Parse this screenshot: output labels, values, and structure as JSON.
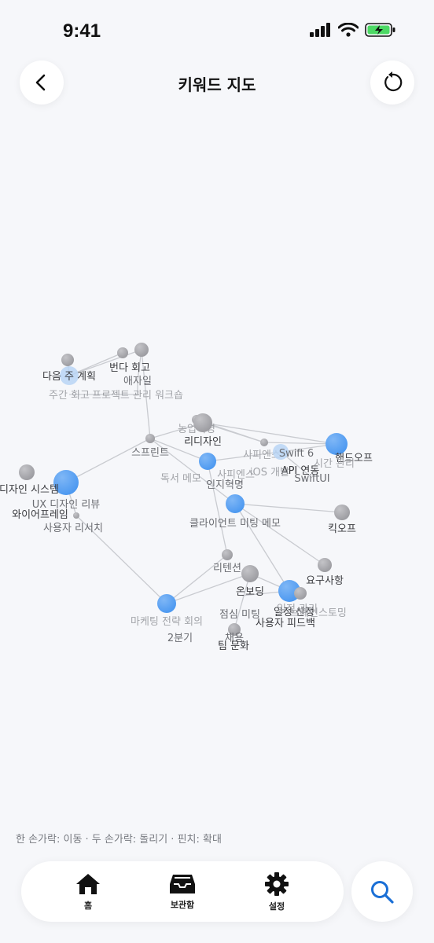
{
  "status": {
    "time": "9:41"
  },
  "header": {
    "title": "키워드 지도",
    "back_icon": "chevron-left-icon",
    "reset_icon": "refresh-icon"
  },
  "map": {
    "colors": {
      "accent": "#4a97f0",
      "light": "#b9d5f5",
      "gray": "#a9a9ad",
      "edge": "#c9cbd0"
    },
    "nodes": [
      {
        "id": "n1",
        "label": "다음 주 계획",
        "kind": "light",
        "emphasis": "dark"
      },
      {
        "id": "n2",
        "label": "",
        "kind": "gray"
      },
      {
        "id": "n3",
        "label": "번다 회고",
        "kind": "gray",
        "emphasis": "dark"
      },
      {
        "id": "n4",
        "label": "",
        "kind": "gray"
      },
      {
        "id": "n5",
        "label": "애자일",
        "kind": "light",
        "emphasis": "mid"
      },
      {
        "id": "n6",
        "label": "주간 회고",
        "kind": "none",
        "emphasis": "faint"
      },
      {
        "id": "n7",
        "label": "프로젝트 관리 워크숍",
        "kind": "none",
        "emphasis": "faint"
      },
      {
        "id": "n8",
        "label": "농업혁명",
        "kind": "gray",
        "emphasis": "faint"
      },
      {
        "id": "n9",
        "label": "리디자인",
        "kind": "gray",
        "emphasis": "dark"
      },
      {
        "id": "n10",
        "label": "스프린트",
        "kind": "gray-small",
        "emphasis": "mid"
      },
      {
        "id": "n11",
        "label": "",
        "kind": "accent"
      },
      {
        "id": "n12",
        "label": "사피엔스",
        "kind": "gray-small",
        "emphasis": "faint"
      },
      {
        "id": "n13",
        "label": "Swift 6",
        "kind": "light",
        "emphasis": "mid"
      },
      {
        "id": "n14",
        "label": "핸드오프",
        "kind": "accent",
        "emphasis": "dark"
      },
      {
        "id": "n15",
        "label": "API 연동",
        "kind": "light",
        "emphasis": "dark"
      },
      {
        "id": "n16",
        "label": "iOS 개발",
        "kind": "none",
        "emphasis": "faint"
      },
      {
        "id": "n17",
        "label": "시간 관리",
        "kind": "none",
        "emphasis": "faint"
      },
      {
        "id": "n18",
        "label": "SwiftUI",
        "kind": "none",
        "emphasis": "mid"
      },
      {
        "id": "n19",
        "label": "독서 메모",
        "kind": "none",
        "emphasis": "faint"
      },
      {
        "id": "n20",
        "label": "사피엔스",
        "kind": "none",
        "emphasis": "faint"
      },
      {
        "id": "n21",
        "label": "인지혁명",
        "kind": "none",
        "emphasis": "mid"
      },
      {
        "id": "n22",
        "label": "디자인 시스템",
        "kind": "accent",
        "emphasis": "dark"
      },
      {
        "id": "n23",
        "label": "",
        "kind": "gray"
      },
      {
        "id": "n24",
        "label": "UX 디자인 리뷰",
        "kind": "none",
        "emphasis": "mid"
      },
      {
        "id": "n25",
        "label": "와이어프레임",
        "kind": "gray-tiny",
        "emphasis": "dark"
      },
      {
        "id": "n26",
        "label": "사용자 리서치",
        "kind": "none",
        "emphasis": "mid"
      },
      {
        "id": "n27",
        "label": "클라이언트 미팅 메모",
        "kind": "accent",
        "emphasis": "mid"
      },
      {
        "id": "n28",
        "label": "킥오프",
        "kind": "gray",
        "emphasis": "dark"
      },
      {
        "id": "n29",
        "label": "요구사항",
        "kind": "gray",
        "emphasis": "dark"
      },
      {
        "id": "n30",
        "label": "리텐션",
        "kind": "gray-small",
        "emphasis": "mid"
      },
      {
        "id": "n31",
        "label": "온보딩",
        "kind": "gray",
        "emphasis": "dark"
      },
      {
        "id": "n32",
        "label": "일정 산정",
        "kind": "accent",
        "emphasis": "dark"
      },
      {
        "id": "n33",
        "label": "일정 관리",
        "kind": "none",
        "emphasis": "faint"
      },
      {
        "id": "n34",
        "label": "브레인스토밍",
        "kind": "none",
        "emphasis": "faint"
      },
      {
        "id": "n35",
        "label": "사용자 피드백",
        "kind": "gray",
        "emphasis": "dark"
      },
      {
        "id": "n36",
        "label": "점심 미팅",
        "kind": "light",
        "emphasis": "mid"
      },
      {
        "id": "n37",
        "label": "마케팅 전략 회의",
        "kind": "accent",
        "emphasis": "faint"
      },
      {
        "id": "n38",
        "label": "2분기",
        "kind": "none",
        "emphasis": "mid"
      },
      {
        "id": "n39",
        "label": "채용",
        "kind": "gray",
        "emphasis": "mid"
      },
      {
        "id": "n40",
        "label": "팀 문화",
        "kind": "none",
        "emphasis": "dark"
      }
    ]
  },
  "hint": "한 손가락: 이동 · 두 손가락: 돌리기 · 핀치: 확대",
  "tabs": [
    {
      "label": "홈",
      "icon": "home-icon"
    },
    {
      "label": "보관함",
      "icon": "inbox-tray-icon"
    },
    {
      "label": "설정",
      "icon": "gear-icon"
    }
  ],
  "search_fab": {
    "icon": "search-icon"
  }
}
